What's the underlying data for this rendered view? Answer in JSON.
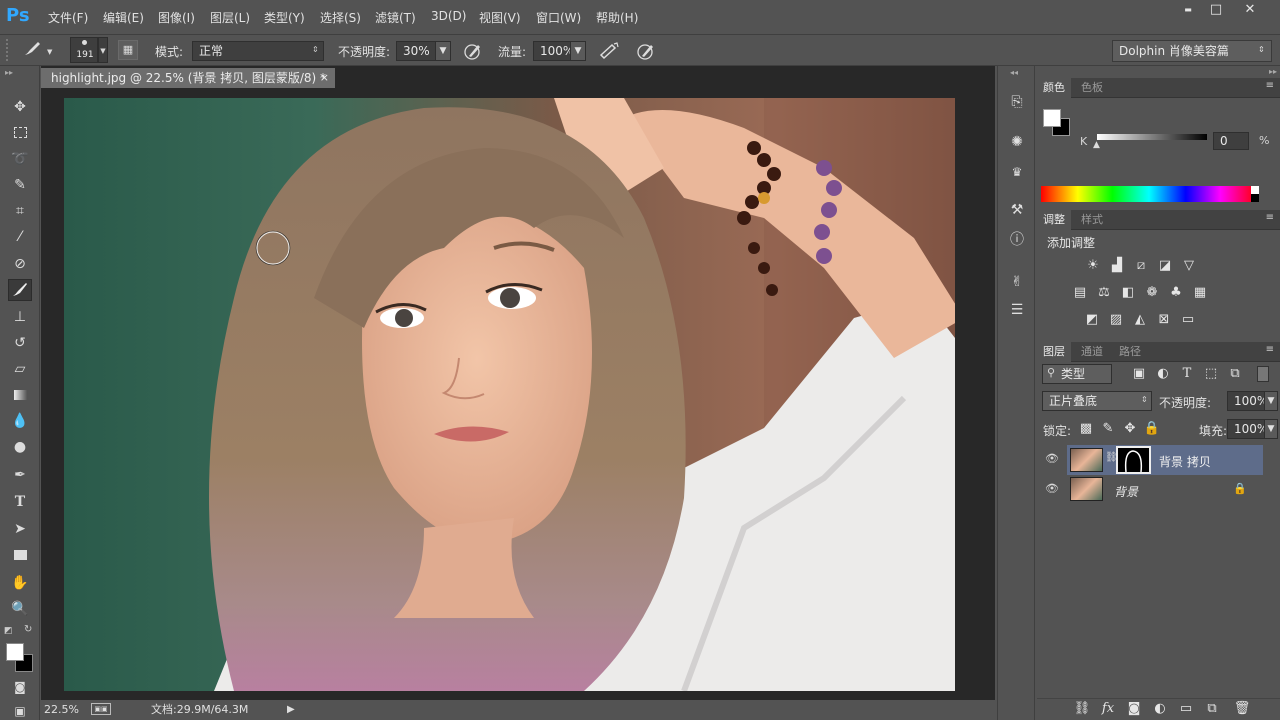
{
  "app": {
    "logo": "Ps"
  },
  "menu": [
    "文件(F)",
    "编辑(E)",
    "图像(I)",
    "图层(L)",
    "类型(Y)",
    "选择(S)",
    "滤镜(T)",
    "3D(D)",
    "视图(V)",
    "窗口(W)",
    "帮助(H)"
  ],
  "window_controls": {
    "minimize": "▬",
    "maximize": "□",
    "close": "✕"
  },
  "options": {
    "brush_size": "191",
    "mode_label": "模式:",
    "mode_value": "正常",
    "opacity_label": "不透明度:",
    "opacity_value": "30%",
    "flow_label": "流量:",
    "flow_value": "100%",
    "workspace": "Dolphin 肖像美容篇"
  },
  "document": {
    "tab_title": "highlight.jpg @ 22.5% (背景 拷贝, 图层蒙版/8) *",
    "close": "×",
    "zoom": "22.5%",
    "doc_size": "文档:29.9M/64.3M"
  },
  "color_panel": {
    "tabs": [
      "颜色",
      "色板"
    ],
    "channel": "K",
    "value": "0",
    "unit": "%"
  },
  "adjust_panel": {
    "tabs": [
      "调整",
      "样式"
    ],
    "title": "添加调整"
  },
  "layers_panel": {
    "tabs": [
      "图层",
      "通道",
      "路径"
    ],
    "filter": "类型",
    "blend_mode": "正片叠底",
    "opacity_label": "不透明度:",
    "opacity_value": "100%",
    "lock_label": "锁定:",
    "fill_label": "填充:",
    "fill_value": "100%",
    "layers": [
      {
        "name": "背景 拷贝",
        "selected": true
      },
      {
        "name": "背景",
        "selected": false
      }
    ]
  },
  "colors": {
    "accent": "#31a8ff",
    "selected_layer": "#5e6c8a",
    "panel_bg": "#535353"
  }
}
